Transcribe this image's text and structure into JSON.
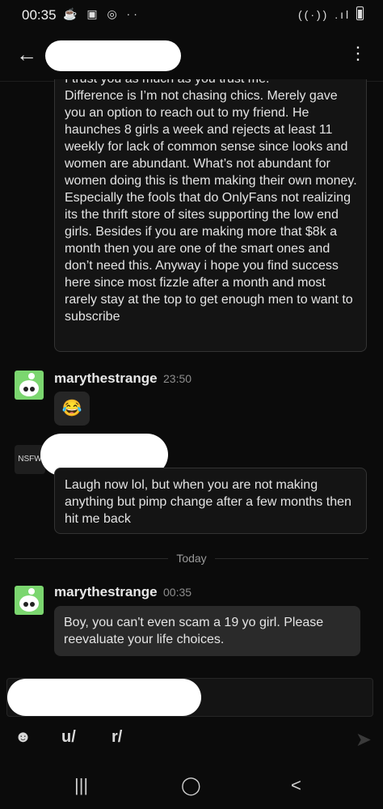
{
  "status_bar": {
    "time": "00:35",
    "left_icons": "☕ ▣ ◎  ··",
    "right_icons": "((·)) .ıl"
  },
  "header": {
    "back_icon": "←",
    "menu_icon": "⋮"
  },
  "messages": [
    {
      "text": "I trust you as much as you trust me.\nDifference is I’m not chasing chics. Merely gave you an option to reach out to my friend. He haunches 8 girls a week and rejects at least 11 weekly for lack of common sense since looks and women are abundant. What’s not abundant for women doing this is them making their own money. Especially the fools that do OnlyFans not realizing its the thrift store of sites supporting the low end girls. Besides if you are making more that $8k a month then you are one of the smart ones and don’t need this. Anyway i hope you find success here since most fizzle after a month and most rarely stay at the top to get enough men to want to subscribe"
    },
    {
      "username": "marythestrange",
      "time": "23:50",
      "emoji": "😂"
    },
    {
      "avatar_label": "NSFW",
      "text": "Laugh now lol, but when you are not making anything but pimp change after a few months then hit me back"
    },
    {
      "username": "marythestrange",
      "time": "00:35",
      "text": "Boy, you can't even scam a 19 yo girl. Please reevaluate your life choices."
    }
  ],
  "divider_label": "Today",
  "composer": {
    "emoji_icon": "☻",
    "user_tool": "u/",
    "subreddit_tool": "r/",
    "send_icon": "➤"
  },
  "navbar": {
    "recents": "|||",
    "home": "◯",
    "back": "<"
  }
}
